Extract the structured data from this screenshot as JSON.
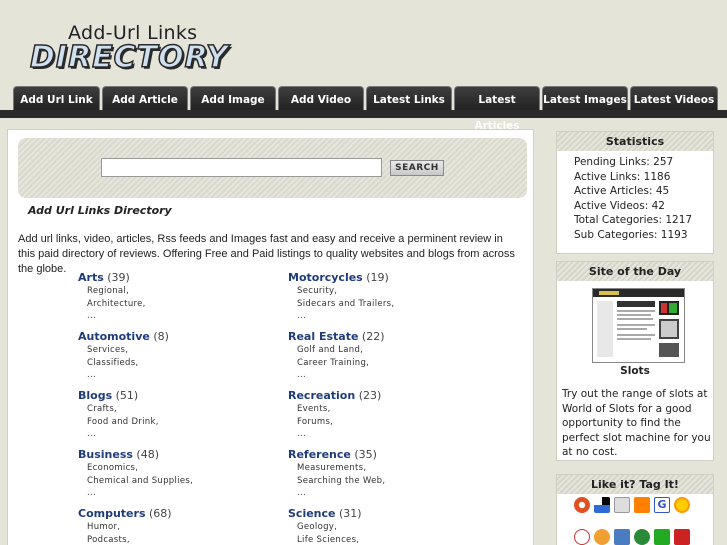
{
  "logo": {
    "line1": "Add-Url Links",
    "line2": "DIRECTORY"
  },
  "nav": {
    "tabs": [
      {
        "label": "Add Url Link"
      },
      {
        "label": "Add Article"
      },
      {
        "label": "Add Image"
      },
      {
        "label": "Add Video"
      },
      {
        "label": "Latest Links"
      },
      {
        "label": "Latest Articles"
      },
      {
        "label": "Latest Images"
      },
      {
        "label": "Latest Videos"
      }
    ]
  },
  "search": {
    "placeholder": "",
    "button_label": "SEARCH"
  },
  "main": {
    "title": "Add Url Links Directory",
    "intro": "Add url links, video, articles, Rss feeds and Images fast and easy and receive a perminent review in this paid directory of reviews. Offering Free and Paid listings to quality websites and blogs from across the globe."
  },
  "categories": [
    {
      "name": "Arts",
      "count": "(39)",
      "subs": [
        "Regional,",
        "Architecture,",
        "..."
      ]
    },
    {
      "name": "Motorcycles",
      "count": "(19)",
      "subs": [
        "Security,",
        "Sidecars and Trailers,",
        "..."
      ]
    },
    {
      "name": "Automotive",
      "count": "(8)",
      "subs": [
        "Services,",
        "Classifieds,",
        "..."
      ]
    },
    {
      "name": "Real Estate",
      "count": "(22)",
      "subs": [
        "Golf and Land,",
        "Career Training,",
        "..."
      ]
    },
    {
      "name": "Blogs",
      "count": "(51)",
      "subs": [
        "Crafts,",
        "Food and Drink,",
        "..."
      ]
    },
    {
      "name": "Recreation",
      "count": "(23)",
      "subs": [
        "Events,",
        "Forums,",
        "..."
      ]
    },
    {
      "name": "Business",
      "count": "(48)",
      "subs": [
        "Economics,",
        "Chemical and Supplies,",
        "..."
      ]
    },
    {
      "name": "Reference",
      "count": "(35)",
      "subs": [
        "Measurements,",
        "Searching the Web,",
        "..."
      ]
    },
    {
      "name": "Computers",
      "count": "(68)",
      "subs": [
        "Humor,",
        "Podcasts,"
      ]
    },
    {
      "name": "Science",
      "count": "(31)",
      "subs": [
        "Geology,",
        "Life Sciences,"
      ]
    }
  ],
  "statistics": {
    "title": "Statistics",
    "lines": [
      "Pending Links: 257",
      "Active Links: 1186",
      "Active Articles: 45",
      "Active Videos: 42",
      "Total Categories: 1217",
      "Sub Categories: 1193"
    ]
  },
  "site_of_day": {
    "title": "Site of the Day",
    "name": "Slots",
    "description": "Try out the range of slots at World of Slots for a good opportunity to find the perfect slot machine for you at no cost."
  },
  "tag_it": {
    "title": "Like it? Tag It!",
    "icons_row1": [
      {
        "name": "digg-icon",
        "color": "#e05020"
      },
      {
        "name": "delicious-icon",
        "color": "#2f6bd6"
      },
      {
        "name": "magnolia-icon",
        "color": "#999999"
      },
      {
        "name": "furl-icon",
        "color": "#ff7f00"
      },
      {
        "name": "google-bookmarks-icon",
        "color": "#3355cc"
      },
      {
        "name": "yahoo-myweb-icon",
        "color": "#ff9900"
      }
    ],
    "icons_row2": [
      {
        "name": "reddit-icon",
        "color": "#cc3333"
      },
      {
        "name": "ma-gnolia-icon",
        "color": "#f0a030"
      },
      {
        "name": "newsvine-icon",
        "color": "#4a7cc0"
      },
      {
        "name": "stumbleupon-icon",
        "color": "#2a8a3a"
      },
      {
        "name": "technorati-icon",
        "color": "#22aa22"
      },
      {
        "name": "yahoo-icon",
        "color": "#cc2222"
      }
    ]
  }
}
